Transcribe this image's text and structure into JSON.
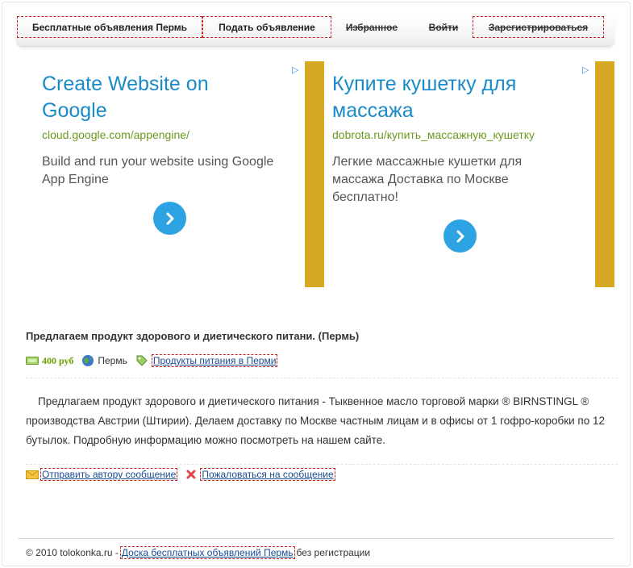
{
  "nav": {
    "items": [
      {
        "label": "Бесплатные объявления Пермь"
      },
      {
        "label": "Подать объявление"
      },
      {
        "label": "Избранное"
      },
      {
        "label": "Войти"
      },
      {
        "label": "Зарегистрироваться"
      }
    ]
  },
  "ads": [
    {
      "title": "Create Website on Google",
      "url": "cloud.google.com/appengine/",
      "description": "Build and run your website using Google App Engine"
    },
    {
      "title": "Купите кушетку для массажа",
      "url": "dobrota.ru/купить_массажную_кушетку",
      "description": "Легкие массажные кушетки для массажа Доставка по Москве бесплатно!"
    }
  ],
  "ad_choices_glyph": "▷",
  "listing": {
    "title": "Предлагаем продукт здорового и диетического питани. (Пермь)",
    "price": "400 руб",
    "city": "Пермь",
    "category": "Продукты питания в Перми",
    "description": "Предлагаем продукт здорового и диетического питания - Тыквенное масло торговой марки ® BIRNSTINGL ® производства Австрии (Штирии). Делаем доставку по Москве частным лицам и в офисы от 1 гофро-коробки по 12 бутылок. Подробную информацию можно посмотреть на нашем сайте."
  },
  "actions": {
    "message_author": "Отправить автору сообщение",
    "report": "Пожаловаться на сообщение"
  },
  "footer": {
    "copyright": "© 2010 tolokonka.ru -",
    "link": "Доска бесплатных объявлений Пермь",
    "suffix": "без регистрации"
  },
  "colors": {
    "ad_title": "#1a8bc8",
    "ad_url": "#6a9a1f",
    "ad_button": "#2ea3e3",
    "ad_stripe": "#d7a823",
    "price": "#6ca100",
    "link": "#1a4d94"
  }
}
